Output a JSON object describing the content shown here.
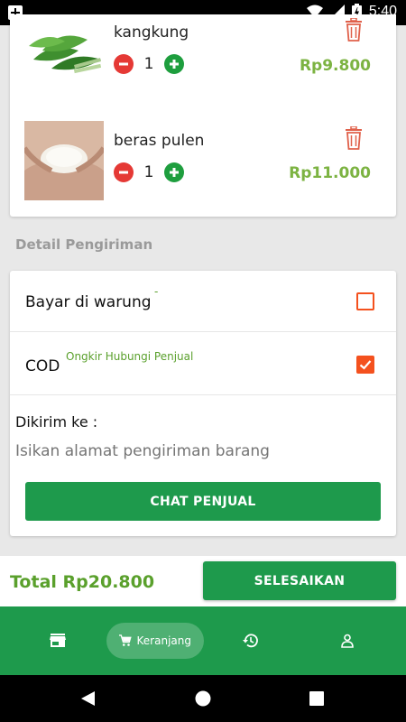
{
  "status_bar": {
    "time": "5:40"
  },
  "cart_items": [
    {
      "name": "kangkung",
      "quantity": "1",
      "price": "Rp9.800"
    },
    {
      "name": "beras pulen",
      "quantity": "1",
      "price": "Rp11.000"
    }
  ],
  "shipping": {
    "section_title": "Detail Pengiriman",
    "options": [
      {
        "label": "Bayar di warung",
        "note": "-",
        "checked": false
      },
      {
        "label": "COD",
        "note": "Ongkir Hubungi Penjual",
        "checked": true
      }
    ],
    "sent_to_label": "Dikirim ke :",
    "address_placeholder": "Isikan alamat pengiriman barang",
    "chat_button": "CHAT PENJUAL"
  },
  "footer": {
    "total": "Total Rp20.800",
    "finish_button": "SELESAIKAN"
  },
  "bottom_nav": {
    "active_label": "Keranjang"
  },
  "colors": {
    "primary_green": "#1e9a4c",
    "price_green": "#7cb342",
    "accent_orange": "#f4511e",
    "minus_red": "#e53935"
  }
}
